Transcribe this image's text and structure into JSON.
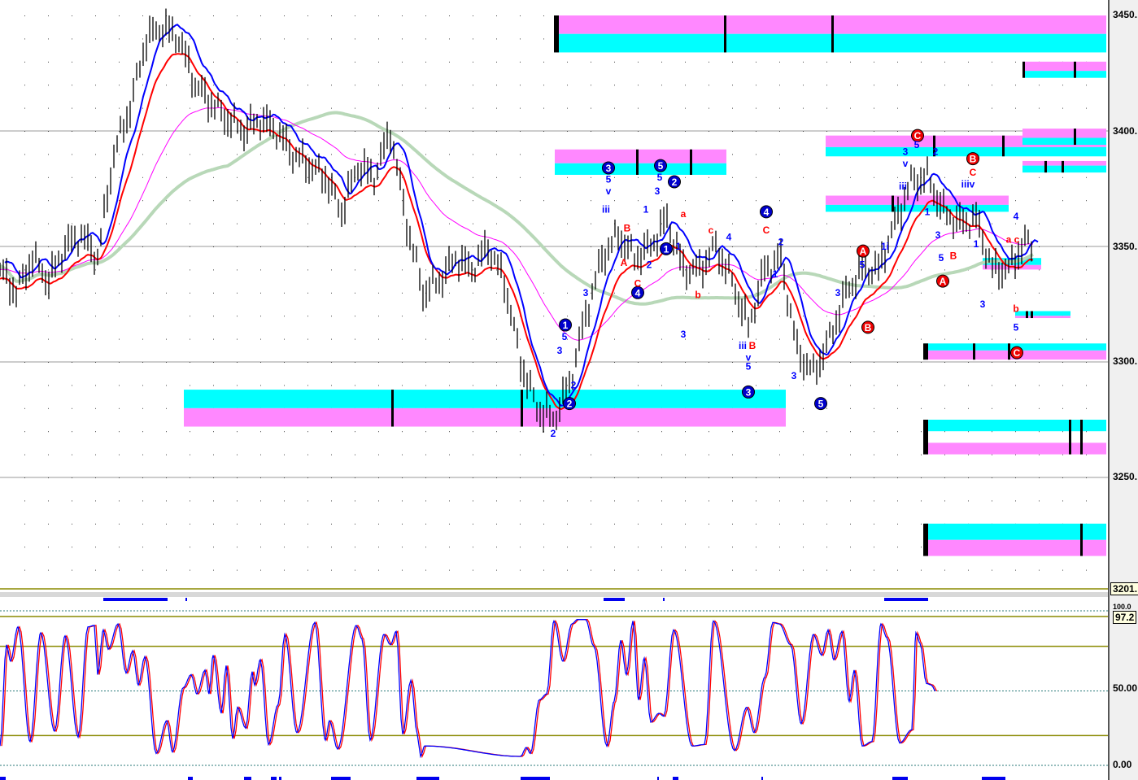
{
  "chart_data": [
    {
      "type": "line",
      "title": "",
      "description_units": "price pane",
      "ylim": [
        3201,
        3455
      ],
      "y_tick_labels": [
        "3450.",
        "3400.",
        "3350.",
        "3300.",
        "3250."
      ],
      "current_price_label": "3201.",
      "series": [
        {
          "name": "close",
          "color": "#000000",
          "t": [
            0,
            20,
            40,
            60,
            80,
            100,
            120,
            140,
            160,
            180,
            200,
            220,
            240,
            260,
            280,
            300,
            320,
            340,
            360,
            380,
            400,
            420,
            440,
            460,
            480,
            500,
            520,
            540,
            560,
            580,
            600,
            620,
            640,
            660,
            680,
            700,
            720,
            740,
            760,
            780,
            800,
            820,
            840,
            860,
            880,
            900,
            920,
            940,
            960,
            980,
            1000,
            1020,
            1040,
            1060,
            1080,
            1100,
            1120,
            1140,
            1160,
            1180,
            1200,
            1220,
            1240,
            1260,
            1270
          ],
          "values": [
            3340,
            3330,
            3345,
            3335,
            3350,
            3355,
            3345,
            3390,
            3410,
            3440,
            3445,
            3440,
            3420,
            3412,
            3405,
            3400,
            3405,
            3400,
            3390,
            3385,
            3380,
            3365,
            3385,
            3380,
            3400,
            3360,
            3330,
            3335,
            3345,
            3340,
            3350,
            3335,
            3300,
            3280,
            3275,
            3290,
            3320,
            3345,
            3355,
            3345,
            3350,
            3362,
            3340,
            3340,
            3350,
            3335,
            3315,
            3340,
            3345,
            3305,
            3295,
            3310,
            3330,
            3340,
            3340,
            3360,
            3378,
            3380,
            3365,
            3360,
            3362,
            3340,
            3340,
            3352,
            3350
          ]
        },
        {
          "name": "fast-average",
          "color": "#0000ff"
        },
        {
          "name": "slow-average",
          "color": "#ff0000"
        },
        {
          "name": "long-average",
          "color": "#ff00ff"
        },
        {
          "name": "trend-average",
          "color": "#b8d8b8"
        }
      ],
      "target_zones": [
        {
          "t": [
            682,
            1360
          ],
          "pink": [
            3442,
            3450
          ],
          "cyan": [
            3434,
            3442
          ],
          "marks": [
            682,
            891,
            1023
          ]
        },
        {
          "t": [
            682,
            893
          ],
          "pink": [
            3386,
            3392
          ],
          "cyan": [
            3381,
            3386
          ],
          "marks": [
            783,
            849
          ]
        },
        {
          "t": [
            1257,
            1360
          ],
          "pink": [
            3426,
            3430
          ],
          "cyan": [
            3423,
            3426
          ],
          "marks": [
            1258,
            1321
          ]
        },
        {
          "t": [
            1015,
            1360
          ],
          "pink": [
            3393,
            3398
          ],
          "cyan": [
            3389,
            3393
          ],
          "marks": [
            1148,
            1233
          ]
        },
        {
          "t": [
            1257,
            1360
          ],
          "pink": [
            3397,
            3401
          ],
          "cyan": [
            3394,
            3397
          ],
          "marks": [
            1321
          ]
        },
        {
          "t": [
            1257,
            1360
          ],
          "pink": [
            3385,
            3387
          ],
          "cyan": [
            3382,
            3385
          ],
          "marks": [
            1285,
            1306
          ]
        },
        {
          "t": [
            1015,
            1240
          ],
          "pink": [
            3368,
            3372
          ],
          "cyan": [
            3365,
            3368
          ],
          "marks": [
            1097
          ]
        },
        {
          "t": [
            226,
            966
          ],
          "cyan": [
            3280,
            3288
          ],
          "pink": [
            3272,
            3280
          ],
          "marks": [
            482,
            641
          ]
        },
        {
          "t": [
            1136,
            1360
          ],
          "cyan": [
            3305,
            3308
          ],
          "pink": [
            3301,
            3305
          ],
          "marks": [
            1136,
            1197,
            1240
          ]
        },
        {
          "t": [
            1136,
            1360
          ],
          "cyan": [
            3270,
            3275
          ],
          "pink": [
            3260,
            3265
          ],
          "marks": [
            1136,
            1315,
            1329
          ]
        },
        {
          "t": [
            1136,
            1360
          ],
          "cyan": [
            3223,
            3230
          ],
          "pink": [
            3216,
            3223
          ],
          "marks": [
            1136,
            1329
          ]
        },
        {
          "t": [
            1208,
            1280
          ],
          "cyan": [
            3342,
            3345
          ],
          "pink": [
            3340,
            3342
          ],
          "marks": []
        },
        {
          "t": [
            1248,
            1316
          ],
          "cyan": [
            3320,
            3322
          ],
          "pink": [
            3319,
            3320
          ],
          "marks": [
            1262,
            1268
          ]
        }
      ],
      "wave_labels_circled": [
        {
          "text": "3",
          "t": 748,
          "p": 3384,
          "color": "blue"
        },
        {
          "text": "5",
          "t": 812,
          "p": 3385,
          "color": "blue"
        },
        {
          "text": "2",
          "t": 829,
          "p": 3378,
          "color": "blue"
        },
        {
          "text": "1",
          "t": 819,
          "p": 3349,
          "color": "blue"
        },
        {
          "text": "4",
          "t": 784,
          "p": 3330,
          "color": "blue"
        },
        {
          "text": "1",
          "t": 695,
          "p": 3316,
          "color": "blue"
        },
        {
          "text": "2",
          "t": 700,
          "p": 3282,
          "color": "blue"
        },
        {
          "text": "4",
          "t": 942,
          "p": 3365,
          "color": "blue"
        },
        {
          "text": "3",
          "t": 920,
          "p": 3287,
          "color": "blue"
        },
        {
          "text": "5",
          "t": 1009,
          "p": 3282,
          "color": "blue"
        },
        {
          "text": "C",
          "t": 1128,
          "p": 3398,
          "color": "red"
        },
        {
          "text": "B",
          "t": 1196,
          "p": 3388,
          "color": "red"
        },
        {
          "text": "A",
          "t": 1061,
          "p": 3348,
          "color": "red"
        },
        {
          "text": "A",
          "t": 1159,
          "p": 3335,
          "color": "red"
        },
        {
          "text": "B",
          "t": 1067,
          "p": 3315,
          "color": "red"
        },
        {
          "text": "C",
          "t": 1250,
          "p": 3304,
          "color": "red"
        }
      ],
      "wave_labels": [
        {
          "text": "5",
          "t": 748,
          "p": 3379,
          "color": "blue"
        },
        {
          "text": "v",
          "t": 748,
          "p": 3374,
          "color": "blue"
        },
        {
          "text": "iii",
          "t": 745,
          "p": 3366,
          "color": "blue"
        },
        {
          "text": "5",
          "t": 811,
          "p": 3380,
          "color": "blue"
        },
        {
          "text": "3",
          "t": 808,
          "p": 3374,
          "color": "blue"
        },
        {
          "text": "1",
          "t": 794,
          "p": 3366,
          "color": "blue"
        },
        {
          "text": "2",
          "t": 798,
          "p": 3342,
          "color": "blue"
        },
        {
          "text": "1",
          "t": 834,
          "p": 3350,
          "color": "blue"
        },
        {
          "text": "3",
          "t": 840,
          "p": 3312,
          "color": "blue"
        },
        {
          "text": "5",
          "t": 694,
          "p": 3311,
          "color": "blue"
        },
        {
          "text": "3",
          "t": 688,
          "p": 3305,
          "color": "blue"
        },
        {
          "text": "2",
          "t": 705,
          "p": 3290,
          "color": "blue"
        },
        {
          "text": "2",
          "t": 680,
          "p": 3269,
          "color": "blue"
        },
        {
          "text": "3",
          "t": 720,
          "p": 3330,
          "color": "blue"
        },
        {
          "text": "4",
          "t": 896,
          "p": 3354,
          "color": "blue"
        },
        {
          "text": "iii",
          "t": 913,
          "p": 3307,
          "color": "blue"
        },
        {
          "text": "v",
          "t": 920,
          "p": 3302,
          "color": "blue"
        },
        {
          "text": "5",
          "t": 920,
          "p": 3298,
          "color": "blue"
        },
        {
          "text": "3",
          "t": 976,
          "p": 3294,
          "color": "blue"
        },
        {
          "text": "1",
          "t": 953,
          "p": 3338,
          "color": "blue"
        },
        {
          "text": "2",
          "t": 960,
          "p": 3352,
          "color": "blue"
        },
        {
          "text": "3",
          "t": 1030,
          "p": 3330,
          "color": "blue"
        },
        {
          "text": "5",
          "t": 1060,
          "p": 3342,
          "color": "blue"
        },
        {
          "text": "1i",
          "t": 1088,
          "p": 3350,
          "color": "blue"
        },
        {
          "text": "3",
          "t": 1113,
          "p": 3391,
          "color": "blue"
        },
        {
          "text": "v",
          "t": 1113,
          "p": 3386,
          "color": "blue"
        },
        {
          "text": "iii",
          "t": 1110,
          "p": 3376,
          "color": "blue"
        },
        {
          "text": "5",
          "t": 1127,
          "p": 3394,
          "color": "blue"
        },
        {
          "text": "2",
          "t": 1150,
          "p": 3391,
          "color": "blue"
        },
        {
          "text": "1",
          "t": 1140,
          "p": 3365,
          "color": "blue"
        },
        {
          "text": "3",
          "t": 1153,
          "p": 3355,
          "color": "blue"
        },
        {
          "text": "5",
          "t": 1157,
          "p": 3345,
          "color": "blue"
        },
        {
          "text": "iiiv",
          "t": 1190,
          "p": 3377,
          "color": "blue"
        },
        {
          "text": "1",
          "t": 1200,
          "p": 3351,
          "color": "blue"
        },
        {
          "text": "3",
          "t": 1208,
          "p": 3325,
          "color": "blue"
        },
        {
          "text": "4",
          "t": 1249,
          "p": 3363,
          "color": "blue"
        },
        {
          "text": "5",
          "t": 1249,
          "p": 3315,
          "color": "blue"
        },
        {
          "text": "A",
          "t": 767,
          "p": 3343,
          "color": "red"
        },
        {
          "text": "B",
          "t": 771,
          "p": 3358,
          "color": "red"
        },
        {
          "text": "C",
          "t": 784,
          "p": 3334,
          "color": "red"
        },
        {
          "text": "a",
          "t": 840,
          "p": 3364,
          "color": "red"
        },
        {
          "text": "b",
          "t": 858,
          "p": 3329,
          "color": "red"
        },
        {
          "text": "c",
          "t": 874,
          "p": 3357,
          "color": "red"
        },
        {
          "text": "C",
          "t": 942,
          "p": 3357,
          "color": "red"
        },
        {
          "text": "B",
          "t": 925,
          "p": 3307,
          "color": "red"
        },
        {
          "text": "B",
          "t": 1172,
          "p": 3346,
          "color": "red"
        },
        {
          "text": "C",
          "t": 1196,
          "p": 3382,
          "color": "red"
        },
        {
          "text": "a",
          "t": 1240,
          "p": 3353,
          "color": "red"
        },
        {
          "text": "c",
          "t": 1250,
          "p": 3353,
          "color": "red"
        },
        {
          "text": "b",
          "t": 1249,
          "p": 3323,
          "color": "red"
        }
      ]
    },
    {
      "type": "line",
      "title": "",
      "description_units": "oscillator pane",
      "ylim": [
        0,
        100
      ],
      "levels": [
        100,
        80,
        50,
        20,
        0
      ],
      "y_tick_labels": [
        "100.0",
        "50.00",
        "0.00"
      ],
      "current_value_label": "97.2",
      "series": [
        {
          "name": "%K",
          "color": "#0000ff",
          "t": [
            0,
            8,
            13,
            22,
            37,
            50,
            67,
            80,
            96,
            108,
            116,
            120,
            127,
            133,
            145,
            155,
            163,
            170,
            178,
            192,
            205,
            212,
            225,
            235,
            242,
            252,
            257,
            262,
            272,
            278,
            286,
            292,
            302,
            310,
            313,
            320,
            330,
            342,
            350,
            365,
            387,
            400,
            405,
            415,
            438,
            445,
            455,
            472,
            480,
            487,
            495,
            505,
            513,
            517,
            522,
            640,
            647,
            652,
            663,
            672,
            681,
            692,
            703,
            710,
            720,
            730,
            746,
            755,
            763,
            770,
            778,
            785,
            792,
            800,
            810,
            816,
            828,
            851,
            866,
            877,
            903,
            918,
            927,
            940,
            950,
            958,
            972,
            985,
            1000,
            1010,
            1018,
            1025,
            1035,
            1044,
            1050,
            1060,
            1072,
            1083,
            1090,
            1106,
            1121,
            1126,
            1131,
            1139,
            1145,
            1150
          ],
          "values": [
            13,
            81,
            70,
            93,
            16,
            89,
            23,
            87,
            19,
            93,
            94,
            61,
            91,
            78,
            95,
            62,
            77,
            54,
            73,
            8,
            30,
            9,
            52,
            61,
            48,
            64,
            48,
            74,
            35,
            67,
            18,
            39,
            25,
            63,
            54,
            71,
            14,
            41,
            88,
            22,
            96,
            17,
            30,
            11,
            94,
            85,
            17,
            88,
            81,
            90,
            21,
            57,
            21,
            6,
            13,
            6,
            12,
            8,
            44,
            48,
            97,
            70,
            95,
            98,
            98,
            80,
            13,
            43,
            84,
            61,
            97,
            44,
            72,
            29,
            35,
            33,
            91,
            13,
            14,
            97,
            10,
            39,
            22,
            59,
            96,
            95,
            81,
            28,
            88,
            74,
            91,
            71,
            90,
            43,
            64,
            13,
            16,
            95,
            86,
            15,
            24,
            89,
            82,
            55,
            54,
            50
          ]
        },
        {
          "name": "%D",
          "color": "#ff0000",
          "lag": 2
        }
      ]
    }
  ]
}
